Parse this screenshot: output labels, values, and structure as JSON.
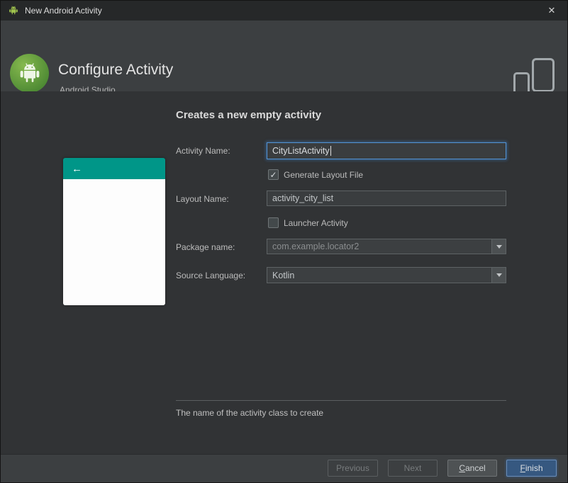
{
  "window": {
    "title": "New Android Activity"
  },
  "icons": {
    "close": "✕",
    "check": "✓",
    "back": "←"
  },
  "header": {
    "title": "Configure Activity",
    "subtitle": "Android Studio"
  },
  "form": {
    "heading": "Creates a new empty activity",
    "activity_name": {
      "label": "Activity Name:",
      "value": "CityListActivity"
    },
    "generate_layout": {
      "label": "Generate Layout File",
      "checked": true
    },
    "layout_name": {
      "label": "Layout Name:",
      "value": "activity_city_list"
    },
    "launcher_activity": {
      "label": "Launcher Activity",
      "checked": false
    },
    "package_name": {
      "label": "Package name:",
      "value": "com.example.locator2"
    },
    "source_language": {
      "label": "Source Language:",
      "value": "Kotlin"
    },
    "hint": "The name of the activity class to create"
  },
  "buttons": {
    "previous": {
      "label": "Previous"
    },
    "next": {
      "label": "Next"
    },
    "cancel": {
      "accel": "C",
      "rest": "ancel"
    },
    "finish": {
      "accel": "F",
      "rest": "inish"
    }
  },
  "colors": {
    "preview_header_teal": "#009688",
    "finish_button_blue": "#365880",
    "focus_border_blue": "#5394d6"
  }
}
